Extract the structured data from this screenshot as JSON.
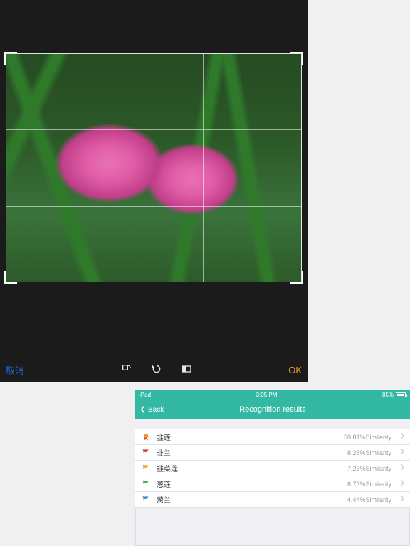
{
  "editor": {
    "cancel_label": "取消",
    "ok_label": "OK",
    "icons": {
      "rotate": "rotate-icon",
      "reset": "reset-icon",
      "aspect": "aspect-icon"
    }
  },
  "statusbar": {
    "carrier": "iPad",
    "time": "3:05 PM",
    "battery_pct": "85%"
  },
  "navbar": {
    "back_label": "Back",
    "title": "Recognition results"
  },
  "similarity_suffix": "Similarity",
  "results": [
    {
      "name": "韭莲",
      "similarity": "50.81%",
      "medal_color": "#e34b3d"
    },
    {
      "name": "韭兰",
      "similarity": "8.28%",
      "medal_color": "#d63f3f"
    },
    {
      "name": "韭菜莲",
      "similarity": "7.26%",
      "medal_color": "#f0a020"
    },
    {
      "name": "葱莲",
      "similarity": "6.73%",
      "medal_color": "#3fb24a"
    },
    {
      "name": "葱兰",
      "similarity": "4.44%",
      "medal_color": "#2f8fe0"
    }
  ]
}
